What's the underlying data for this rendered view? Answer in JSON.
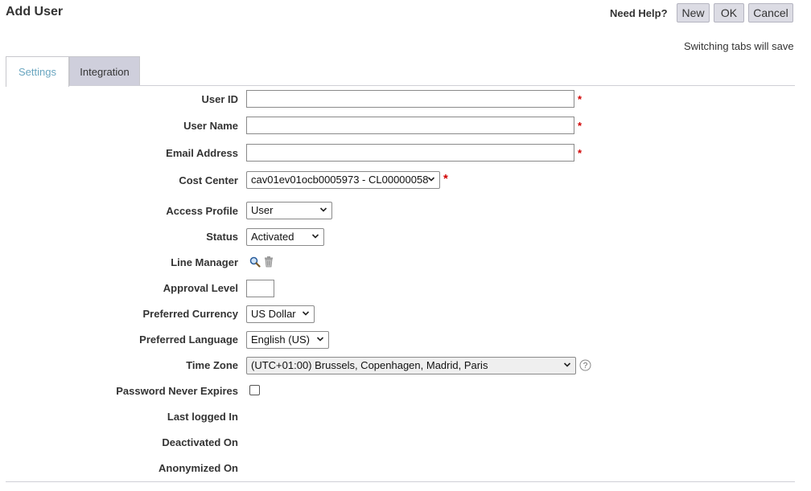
{
  "header": {
    "title": "Add User",
    "help_label": "Need Help?",
    "buttons": {
      "new": "New",
      "ok": "OK",
      "cancel": "Cancel"
    },
    "note": "Switching tabs will save"
  },
  "tabs": [
    {
      "label": "Settings",
      "active": true
    },
    {
      "label": "Integration",
      "active": false
    }
  ],
  "form": {
    "user_id": {
      "label": "User ID",
      "value": "",
      "required": "*"
    },
    "user_name": {
      "label": "User Name",
      "value": "",
      "required": "*"
    },
    "email": {
      "label": "Email Address",
      "value": "",
      "required": "*"
    },
    "cost_center": {
      "label": "Cost Center",
      "value": "cav01ev01ocb0005973 - CL00000058",
      "required": "*"
    },
    "access_profile": {
      "label": "Access Profile",
      "value": "User"
    },
    "status": {
      "label": "Status",
      "value": "Activated"
    },
    "line_manager": {
      "label": "Line Manager"
    },
    "approval_level": {
      "label": "Approval Level",
      "value": ""
    },
    "preferred_currency": {
      "label": "Preferred Currency",
      "value": "US Dollar"
    },
    "preferred_language": {
      "label": "Preferred Language",
      "value": "English (US)"
    },
    "time_zone": {
      "label": "Time Zone",
      "value": "(UTC+01:00) Brussels, Copenhagen, Madrid, Paris"
    },
    "password_never_expires": {
      "label": "Password Never Expires",
      "checked": false
    },
    "last_logged_in": {
      "label": "Last logged In"
    },
    "deactivated_on": {
      "label": "Deactivated On"
    },
    "anonymized_on": {
      "label": "Anonymized On"
    }
  },
  "icons": {
    "search": "magnifier-icon",
    "delete": "trash-icon",
    "help": "question-circle-icon",
    "dropdown": "chevron-down-icon"
  },
  "colors": {
    "required": "#d00000",
    "active_tab_text": "#6aa6c0",
    "inactive_tab_bg": "#cfcfdc",
    "button_bg": "#dcdce4"
  }
}
